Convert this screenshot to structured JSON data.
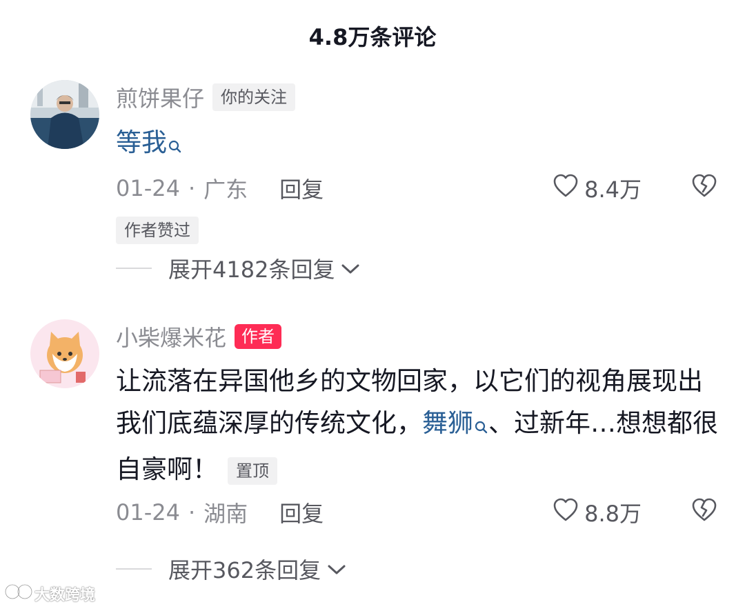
{
  "header": {
    "title": "4.8万条评论"
  },
  "comments": [
    {
      "username": "煎饼果仔",
      "tag": "你的关注",
      "text_link": "等我",
      "date": "01-24",
      "location": "广东",
      "reply_label": "回复",
      "likes": "8.4万",
      "author_liked": "作者赞过",
      "expand_label": "展开4182条回复"
    },
    {
      "username": "小柴爆米花",
      "tag": "作者",
      "text_part1": "让流落在异国他乡的文物回家，以它们的视角展现出我们底蕴深厚的传统文化，",
      "text_link": "舞狮",
      "text_part2": "、过新年…想想都很自豪啊！",
      "pin_tag": "置顶",
      "date": "01-24",
      "location": "湖南",
      "reply_label": "回复",
      "likes": "8.8万",
      "expand_label": "展开362条回复"
    }
  ],
  "meta_separator": "·",
  "watermark": {
    "text": "大数跨境"
  },
  "colors": {
    "link": "#2a5f95",
    "author_tag": "#fe2c55",
    "muted": "#8a8b91"
  },
  "icons": [
    "search-icon",
    "heart-icon",
    "broken-heart-icon",
    "chevron-down-icon"
  ]
}
